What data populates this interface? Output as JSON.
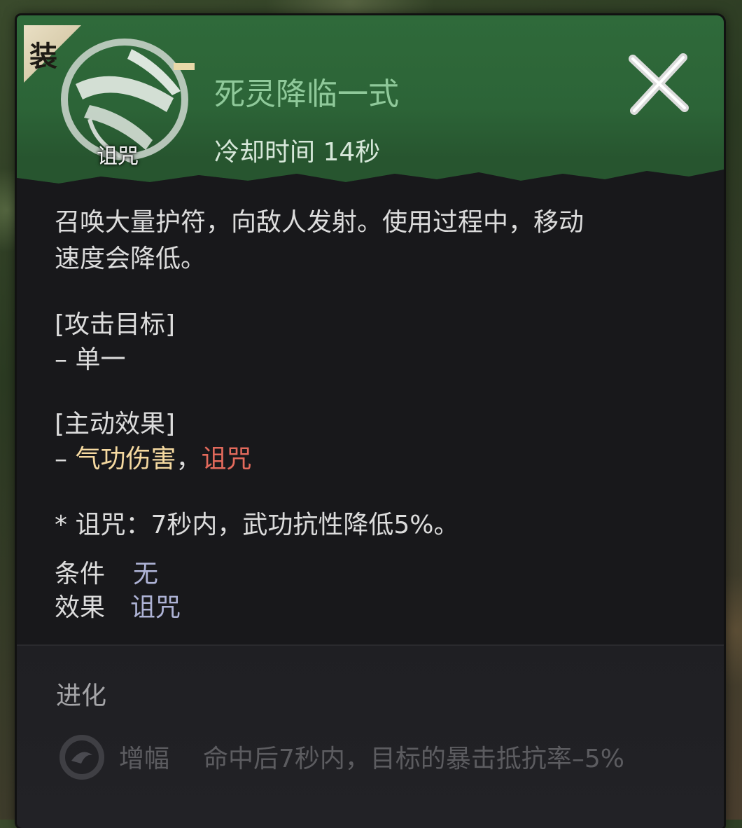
{
  "skill": {
    "equip_badge": "装",
    "icon_label": "诅咒",
    "title": "死灵降临一式",
    "cooldown": "冷却时间 14秒"
  },
  "description": {
    "line1": "召唤大量护符，向敌人发射。使用过程中，移动",
    "line2": "速度会降低。",
    "target_header": "[攻击目标]",
    "target_prefix": "– ",
    "target_value": "单一",
    "effect_header": "[主动效果]",
    "effect_prefix": "– ",
    "effect_damage": "气功伤害",
    "effect_sep": "，",
    "effect_curse": "诅咒",
    "footnote": "* 诅咒：7秒内，武功抗性降低5%。",
    "condition_label": "条件",
    "condition_value": "无",
    "effect_label": "效果",
    "effect_value": "诅咒"
  },
  "evolution": {
    "title": "进化",
    "name": "增幅",
    "desc": "命中后7秒内，目标的暴击抵抗率–5%"
  },
  "colors": {
    "header_green": "#2f6a3a",
    "title_green": "#8fc99a",
    "highlight_gold": "#f5d9a0",
    "highlight_red": "#e36a5c",
    "value_blue": "#aeb3d6"
  },
  "icons": {
    "close": "close-x-icon",
    "skill": "talisman-icon",
    "evolve": "swirl-icon"
  }
}
